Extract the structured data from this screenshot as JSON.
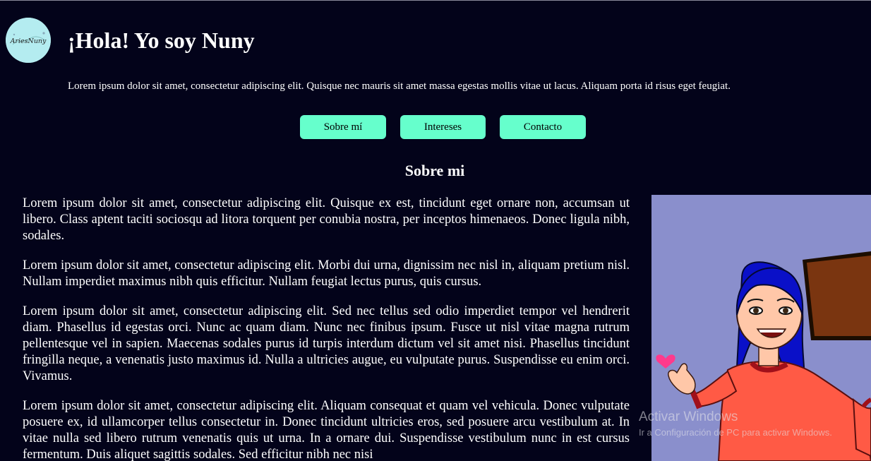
{
  "header": {
    "logo_text": "AriesNuny",
    "title": "¡Hola! Yo soy Nuny",
    "intro": "Lorem ipsum dolor sit amet, consectetur adipiscing elit. Quisque nec mauris sit amet massa egestas mollis vitae ut lacus. Aliquam porta id risus eget feugiat."
  },
  "nav": {
    "items": [
      {
        "label": "Sobre mí"
      },
      {
        "label": "Intereses"
      },
      {
        "label": "Contacto"
      }
    ]
  },
  "about": {
    "title": "Sobre mi",
    "paragraphs": [
      "Lorem ipsum dolor sit amet, consectetur adipiscing elit. Quisque ex est, tincidunt eget ornare non, accumsan ut libero. Class aptent taciti sociosqu ad litora torquent per conubia nostra, per inceptos himenaeos. Donec ligula nibh, sodales.",
      "Lorem ipsum dolor sit amet, consectetur adipiscing elit. Morbi dui urna, dignissim nec nisl in, aliquam pretium nisl. Nullam imperdiet maximus nibh quis efficitur. Nullam feugiat lectus purus, quis cursus.",
      "Lorem ipsum dolor sit amet, consectetur adipiscing elit. Sed nec tellus sed odio imperdiet tempor vel hendrerit diam. Phasellus id egestas orci. Nunc ac quam diam. Nunc nec finibus ipsum. Fusce ut nisl vitae magna rutrum pellentesque vel in sapien. Maecenas sodales purus id turpis interdum dictum vel sit amet nisi. Phasellus tincidunt fringilla neque, a venenatis justo maximus id. Nulla a ultricies augue, eu vulputate purus. Suspendisse eu enim orci. Vivamus.",
      "Lorem ipsum dolor sit amet, consectetur adipiscing elit. Aliquam consequat et quam vel vehicula. Donec vulputate posuere ex, id ullamcorper tellus consectetur in. Donec tincidunt ultricies eros, sed posuere arcu vestibulum at. In vitae nulla sed libero rutrum venenatis quis ut urna. In a ornare dui. Suspendisse vestibulum nunc in est cursus fermentum. Duis aliquet sagittis sodales. Sed efficitur nibh nec nisi"
    ]
  },
  "watermark": {
    "title": "Activar Windows",
    "subtitle": "Ir a Configuración de PC para activar Windows."
  },
  "colors": {
    "background": "#03031a",
    "button": "#66ffcc",
    "logo_bg": "#b4ecf0",
    "portrait_bg": "#8a8fcc"
  }
}
